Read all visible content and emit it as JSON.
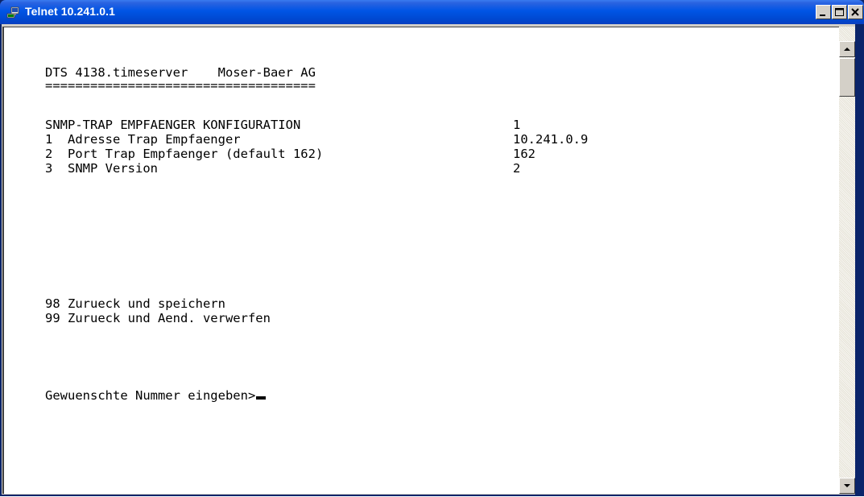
{
  "window": {
    "title": "Telnet 10.241.0.1"
  },
  "terminal": {
    "header_device": "DTS 4138.timeserver",
    "header_vendor": "Moser-Baer AG",
    "separator": "====================================",
    "section_title": "SNMP-TRAP EMPFAENGER KONFIGURATION",
    "section_value": "1",
    "items": [
      {
        "label": "1  Adresse Trap Empfaenger",
        "value": "10.241.0.9"
      },
      {
        "label": "2  Port Trap Empfaenger (default 162)",
        "value": "162"
      },
      {
        "label": "3  SNMP Version",
        "value": "2"
      }
    ],
    "actions": [
      {
        "label": "98 Zurueck und speichern"
      },
      {
        "label": "99 Zurueck und Aend. verwerfen"
      }
    ],
    "prompt": "Gewuenschte Nummer eingeben>"
  },
  "icons": {
    "app": "telnet-computer-icon",
    "minimize": "minimize-icon",
    "maximize": "maximize-icon",
    "close": "close-icon",
    "scroll_up": "scroll-up-arrow-icon",
    "scroll_down": "scroll-down-arrow-icon"
  },
  "colors": {
    "titlebar": "#0055e5",
    "terminal_bg": "#ffffff",
    "terminal_text": "#000000",
    "chrome": "#d4d0c8"
  }
}
